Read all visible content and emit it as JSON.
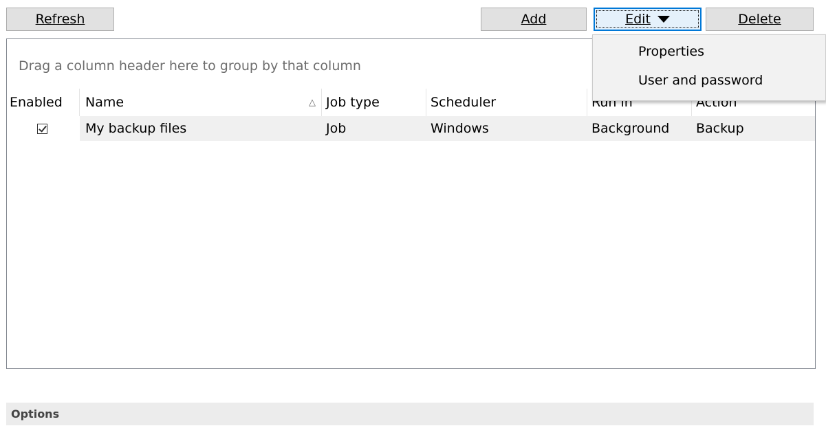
{
  "toolbar": {
    "refresh_label": "Refresh",
    "add_label": "Add",
    "edit_label": "Edit",
    "delete_label": "Delete"
  },
  "grid": {
    "group_hint": "Drag a column header here to group by that column",
    "columns": [
      "Enabled",
      "Name",
      "Job type",
      "Scheduler",
      "Run in",
      "Action"
    ],
    "sort_indicator": "△",
    "rows": [
      {
        "enabled": true,
        "name": "My backup files",
        "job_type": "Job",
        "scheduler": "Windows",
        "run_in": "Background",
        "action": "Backup"
      }
    ]
  },
  "edit_menu": {
    "items": [
      "Properties",
      "User and password"
    ]
  },
  "options": {
    "title": "Options"
  },
  "colors": {
    "accent": "#0078d7",
    "button_bg": "#e1e1e1",
    "selected_row": "#f0f0f0"
  }
}
